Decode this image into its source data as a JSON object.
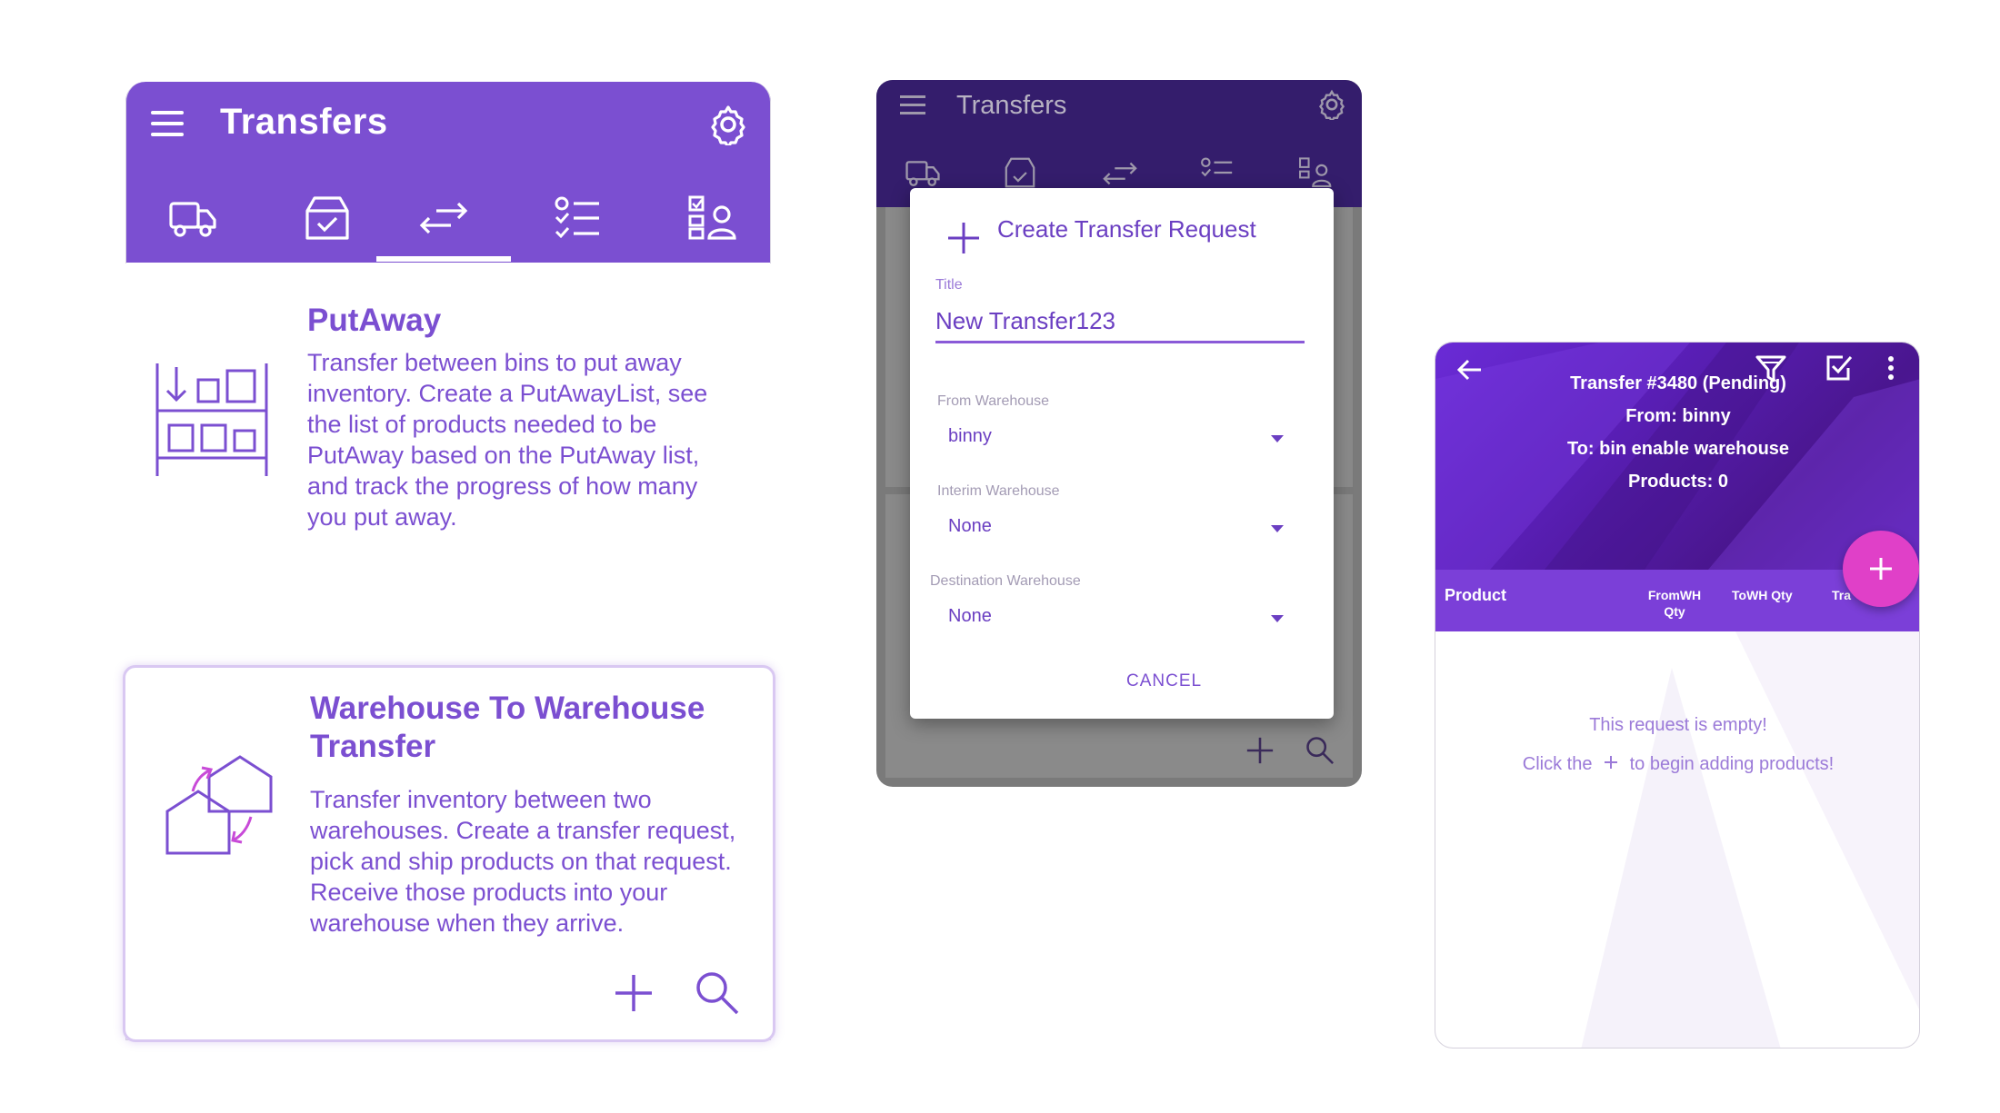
{
  "screen1": {
    "title": "Transfers",
    "cards": [
      {
        "title": "PutAway",
        "description": "Transfer between bins to put away inventory. Create a PutAwayList, see the list of products needed to be PutAway based on the PutAway list, and track the progress of how many you put away."
      },
      {
        "title": "Warehouse To Warehouse Transfer",
        "description": "Transfer inventory between two warehouses. Create a transfer request, pick and ship products on that request. Receive those products into your warehouse when they arrive."
      }
    ]
  },
  "screen2": {
    "title": "Transfers",
    "dialog": {
      "title": "Create Transfer Request",
      "title_label": "Title",
      "title_value": "New Transfer123",
      "from_label": "From Warehouse",
      "from_value": "binny",
      "interim_label": "Interim Warehouse",
      "interim_value": "None",
      "dest_label": "Destination Warehouse",
      "dest_value": "None",
      "cancel_label": "CANCEL"
    }
  },
  "screen3": {
    "header_lines": [
      "Transfer #3480 (Pending)",
      "From: binny",
      "To: bin enable warehouse",
      "Products: 0"
    ],
    "columns": {
      "product": "Product",
      "fromwh": "FromWH",
      "fromwh2": "Qty",
      "towh": "ToWH Qty",
      "transfer": "Tra"
    },
    "empty_line1": "This request is empty!",
    "empty_line2_a": "Click the",
    "empty_line2_b": "to begin adding products!"
  },
  "colors": {
    "primary": "#7b4fd1",
    "primary_dark": "#341d6c",
    "fab": "#e040c8"
  }
}
